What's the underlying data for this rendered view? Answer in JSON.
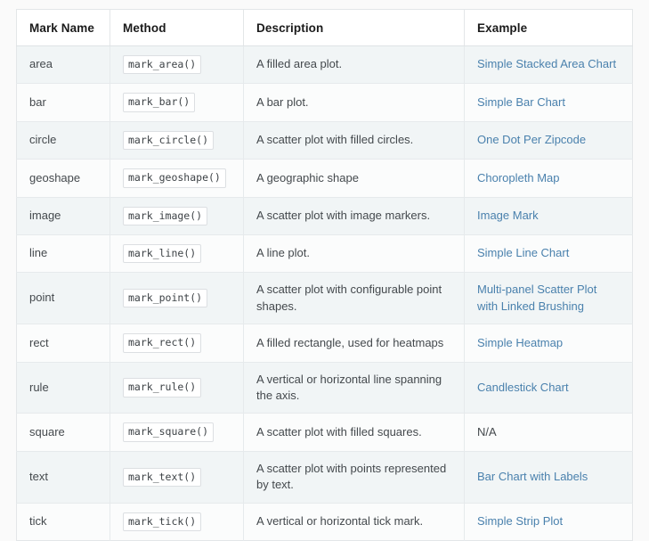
{
  "table": {
    "columns": [
      {
        "key": "mark_name",
        "label": "Mark Name"
      },
      {
        "key": "method",
        "label": "Method"
      },
      {
        "key": "description",
        "label": "Description"
      },
      {
        "key": "example",
        "label": "Example"
      }
    ],
    "rows": [
      {
        "mark_name": "area",
        "method": "mark_area()",
        "description": "A filled area plot.",
        "example": "Simple Stacked Area Chart",
        "example_is_link": true
      },
      {
        "mark_name": "bar",
        "method": "mark_bar()",
        "description": "A bar plot.",
        "example": "Simple Bar Chart",
        "example_is_link": true
      },
      {
        "mark_name": "circle",
        "method": "mark_circle()",
        "description": "A scatter plot with filled circles.",
        "example": "One Dot Per Zipcode",
        "example_is_link": true
      },
      {
        "mark_name": "geoshape",
        "method": "mark_geoshape()",
        "description": "A geographic shape",
        "example": "Choropleth Map",
        "example_is_link": true
      },
      {
        "mark_name": "image",
        "method": "mark_image()",
        "description": "A scatter plot with image markers.",
        "example": "Image Mark",
        "example_is_link": true
      },
      {
        "mark_name": "line",
        "method": "mark_line()",
        "description": "A line plot.",
        "example": "Simple Line Chart",
        "example_is_link": true
      },
      {
        "mark_name": "point",
        "method": "mark_point()",
        "description": "A scatter plot with configurable point shapes.",
        "example": "Multi-panel Scatter Plot with Linked Brushing",
        "example_is_link": true
      },
      {
        "mark_name": "rect",
        "method": "mark_rect()",
        "description": "A filled rectangle, used for heatmaps",
        "example": "Simple Heatmap",
        "example_is_link": true
      },
      {
        "mark_name": "rule",
        "method": "mark_rule()",
        "description": "A vertical or horizontal line spanning the axis.",
        "example": "Candlestick Chart",
        "example_is_link": true
      },
      {
        "mark_name": "square",
        "method": "mark_square()",
        "description": "A scatter plot with filled squares.",
        "example": "N/A",
        "example_is_link": false
      },
      {
        "mark_name": "text",
        "method": "mark_text()",
        "description": "A scatter plot with points represented by text.",
        "example": "Bar Chart with Labels",
        "example_is_link": true
      },
      {
        "mark_name": "tick",
        "method": "mark_tick()",
        "description": "A vertical or horizontal tick mark.",
        "example": "Simple Strip Plot",
        "example_is_link": true
      }
    ]
  },
  "colors": {
    "link": "#4a81ad",
    "text": "#44494d",
    "header_text": "#1b1b1b",
    "stripe": "#f1f5f6",
    "row": "#fbfcfc",
    "border": "#e6eaec",
    "page_background": "#fafafa"
  }
}
